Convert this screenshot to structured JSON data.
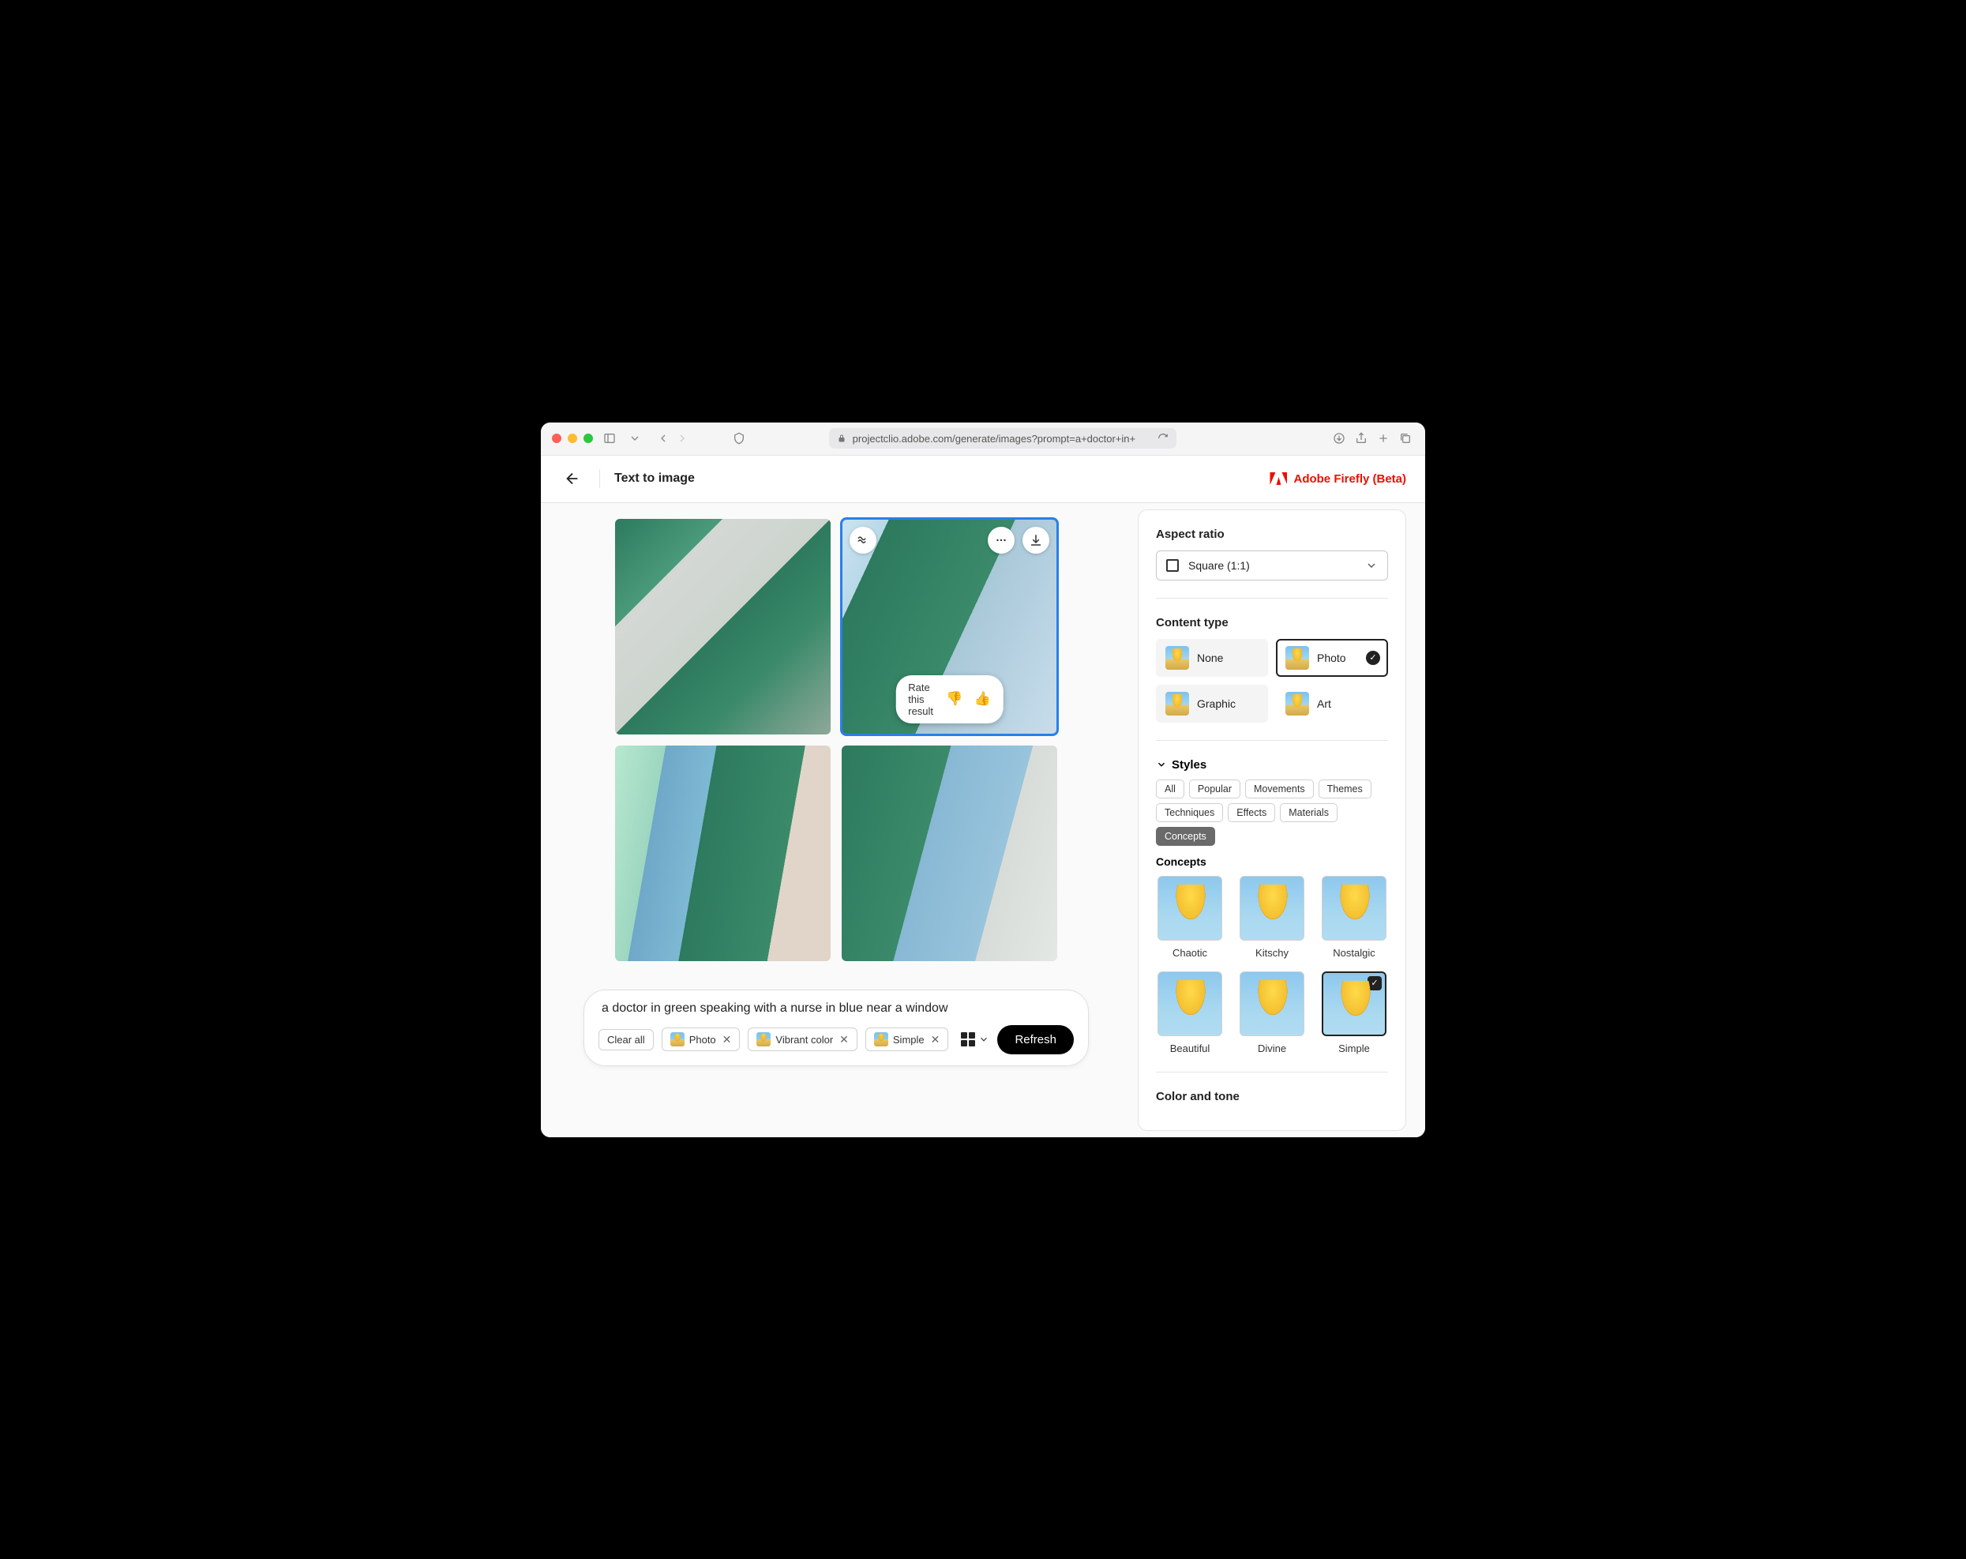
{
  "browser": {
    "url": "projectclio.adobe.com/generate/images?prompt=a+doctor+in+"
  },
  "header": {
    "title": "Text to image",
    "brand": "Adobe Firefly (Beta)"
  },
  "grid": {
    "rate_label": "Rate this result"
  },
  "prompt": {
    "text": "a doctor in green speaking with a nurse in blue near a window",
    "clear_label": "Clear all",
    "chips": [
      {
        "label": "Photo"
      },
      {
        "label": "Vibrant color"
      },
      {
        "label": "Simple"
      }
    ],
    "refresh_label": "Refresh"
  },
  "sidebar": {
    "aspect": {
      "heading": "Aspect ratio",
      "value": "Square (1:1)"
    },
    "content_type": {
      "heading": "Content type",
      "options": [
        {
          "label": "None",
          "selected": false
        },
        {
          "label": "Photo",
          "selected": true
        },
        {
          "label": "Graphic",
          "selected": false
        },
        {
          "label": "Art",
          "selected": false
        }
      ]
    },
    "styles": {
      "heading": "Styles",
      "tags": [
        "All",
        "Popular",
        "Movements",
        "Themes",
        "Techniques",
        "Effects",
        "Materials",
        "Concepts"
      ],
      "active_tag": "Concepts",
      "concepts_heading": "Concepts",
      "concepts": [
        {
          "label": "Chaotic",
          "selected": false
        },
        {
          "label": "Kitschy",
          "selected": false
        },
        {
          "label": "Nostalgic",
          "selected": false
        },
        {
          "label": "Beautiful",
          "selected": false
        },
        {
          "label": "Divine",
          "selected": false
        },
        {
          "label": "Simple",
          "selected": true
        }
      ]
    },
    "color_tone_heading": "Color and tone"
  }
}
